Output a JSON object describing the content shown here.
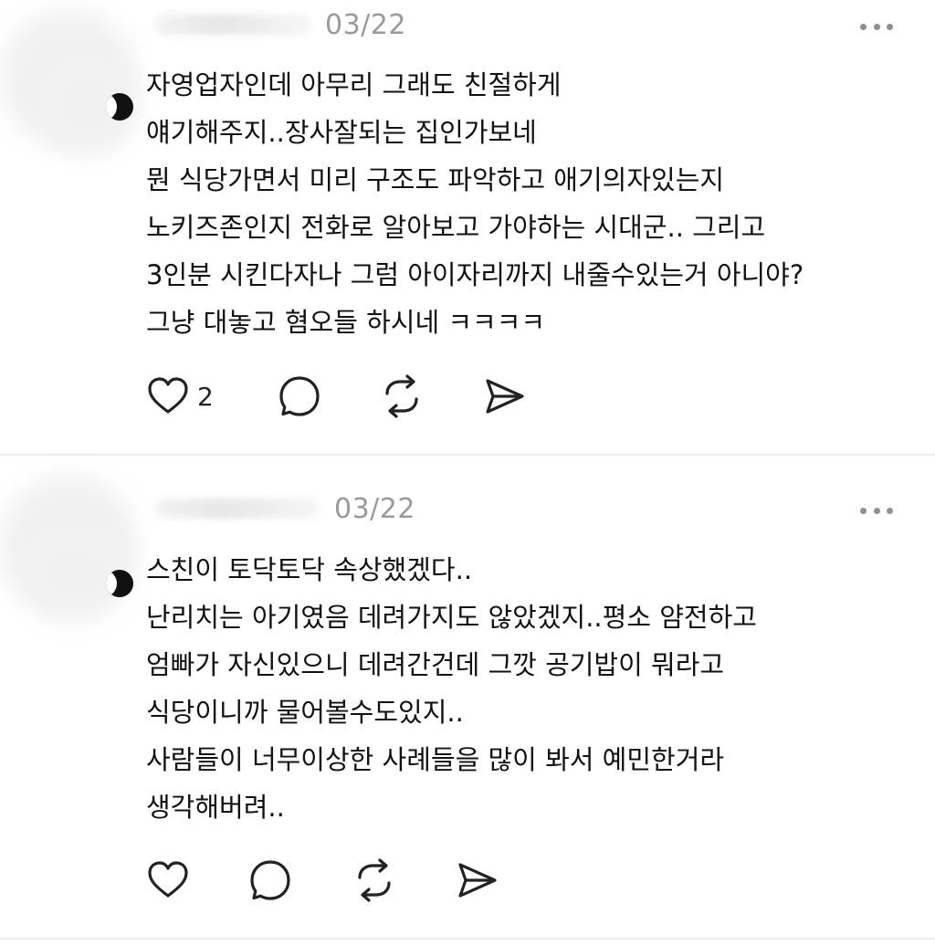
{
  "posts": [
    {
      "date": "03/22",
      "lines": [
        "자영업자인데 아무리 그래도  친절하게",
        "얘기해주지..장사잘되는 집인가보네",
        "뭔 식당가면서 미리 구조도 파악하고 애기의자있는지",
        "노키즈존인지 전화로 알아보고 가야하는 시대군.. 그리고",
        "3인분 시킨다자나 그럼 아이자리까지 내줄수있는거 아니야?",
        "그냥 대놓고 혐오들 하시네 ㅋㅋㅋㅋ"
      ],
      "like_count": "2",
      "icons": {
        "more": "more-dots-icon",
        "like": "heart-icon",
        "reply": "comment-bubble-icon",
        "repost": "repost-icon",
        "share": "send-icon"
      }
    },
    {
      "date": "03/22",
      "lines": [
        "스친이 토닥토닥 속상했겠다..",
        "난리치는 아기였음 데려가지도 않았겠지..평소 얌전하고",
        "엄빠가 자신있으니 데려간건데 그깟 공기밥이 뭐라고",
        "식당이니까 물어볼수도있지..",
        "사람들이 너무이상한 사례들을 많이 봐서 예민한거라",
        "생각해버려.."
      ],
      "like_count": "",
      "icons": {
        "more": "more-dots-icon",
        "like": "heart-icon",
        "reply": "comment-bubble-icon",
        "repost": "repost-icon",
        "share": "send-icon"
      }
    }
  ],
  "colors": {
    "text": "#111111",
    "muted": "#9a9a9a",
    "icon": "#222222",
    "divider": "#ececec"
  }
}
